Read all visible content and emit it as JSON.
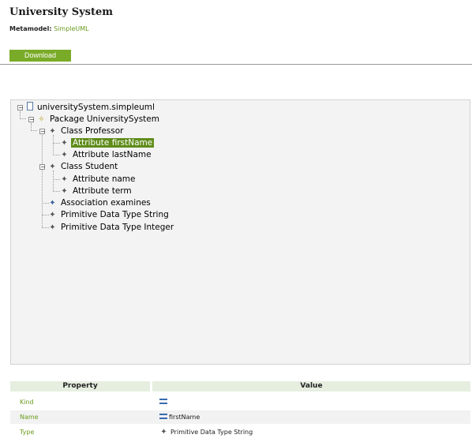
{
  "header": {
    "title": "University System",
    "metamodel_label": "Metamodel:",
    "metamodel_value": "SimpleUML",
    "download_label": "Download"
  },
  "tree": {
    "root": "universitySystem.simpleuml",
    "package": "Package UniversitySystem",
    "class_professor": "Class Professor",
    "attr_firstname": "Attribute firstName",
    "attr_lastname": "Attribute lastName",
    "class_student": "Class Student",
    "attr_name": "Attribute name",
    "attr_term": "Attribute term",
    "assoc": "Association examines",
    "prim_string": "Primitive Data Type String",
    "prim_integer": "Primitive Data Type Integer",
    "collapse_glyph": "−"
  },
  "properties": {
    "col_property": "Property",
    "col_value": "Value",
    "rows": [
      {
        "key": "Kind",
        "value": ""
      },
      {
        "key": "Name",
        "value": "firstName"
      },
      {
        "key": "Type",
        "value": "Primitive Data Type String"
      }
    ]
  },
  "icons": {
    "class_glyph": "✦",
    "package_glyph": "✧"
  },
  "colors": {
    "accent_green": "#7aab28",
    "selection_green": "#5f8c1a",
    "key_green": "#6b9c1f"
  }
}
